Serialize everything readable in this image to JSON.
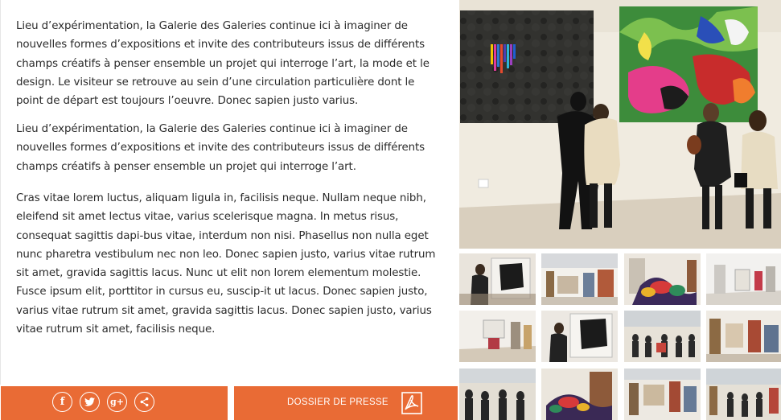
{
  "content": {
    "paragraphs": [
      "Lieu d’expérimentation, la Galerie des Galeries continue ici à imaginer de nouvelles formes d’expositions et invite des contributeurs issus de différents champs créatifs à penser ensemble un projet qui interroge l’art, la mode et le design. Le visiteur se retrouve au sein d’une circulation particulière dont le point de départ est toujours l’oeuvre. Donec sapien justo varius.",
      "Lieu d’expérimentation, la Galerie des Galeries continue ici à imaginer de nouvelles formes d’expositions et invite des contributeurs issus de différents champs créatifs à penser ensemble un projet qui interroge l’art.",
      "Cras vitae lorem luctus, aliquam ligula in, facilisis neque. Nullam neque nibh, eleifend sit amet lectus vitae, varius scelerisque magna. In metus risus, consequat sagittis dapi-bus vitae, interdum non nisi. Phasellus non nulla eget nunc pharetra vestibulum nec non leo. Donec sapien justo, varius vitae rutrum sit amet, gravida sagittis lacus. Nunc ut elit non lorem elementum molestie. Fusce ipsum elit, porttitor  in cursus eu, suscip-it ut lacus. Donec sapien justo, varius vitae rutrum sit amet, gravida sagittis lacus. Donec sapien justo, varius vitae rutrum sit amet, facilisis neque."
    ]
  },
  "share_bar": {
    "icons": [
      {
        "name": "facebook-icon",
        "glyph": "f"
      },
      {
        "name": "twitter-icon",
        "glyph": ""
      },
      {
        "name": "google-plus-icon",
        "glyph": "g+"
      },
      {
        "name": "share-icon",
        "glyph": ""
      }
    ]
  },
  "press": {
    "label": "DOSSIER DE PRESSE",
    "icon": "pdf-icon"
  },
  "colors": {
    "accent": "#e96b35",
    "text": "#2b2b2b",
    "background": "#ffffff"
  },
  "gallery": {
    "hero_subject": "gallery-visitors-viewing-paintings",
    "thumbnail_count": 12
  }
}
